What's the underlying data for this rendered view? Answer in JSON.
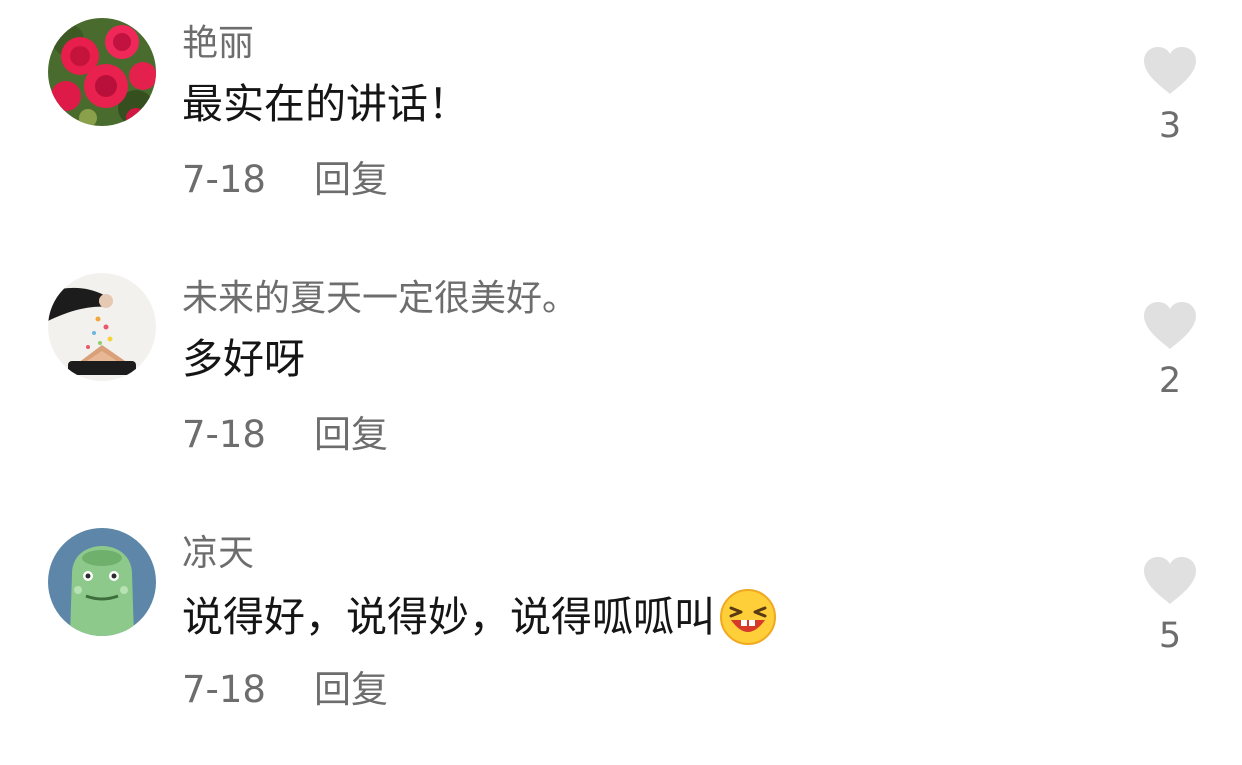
{
  "comments": [
    {
      "username": "艳丽",
      "avatar": "rose-flowers-avatar",
      "text": "最实在的讲话！",
      "date": "7-18",
      "reply_label": "回复",
      "likes": "3"
    },
    {
      "username": "未来的夏天一定很美好。",
      "avatar": "hand-sprinkling-avatar",
      "text": "多好呀",
      "date": "7-18",
      "reply_label": "回复",
      "likes": "2"
    },
    {
      "username": "凉天",
      "avatar": "green-dinosaur-avatar",
      "text": "说得好，说得妙，说得呱呱叫",
      "emoji": "laughing-face-emoji",
      "date": "7-18",
      "reply_label": "回复",
      "likes": "5"
    }
  ],
  "colors": {
    "text_primary": "#151515",
    "text_secondary": "#6d6d6d",
    "heart_gray": "#e0e0e0",
    "background": "#ffffff"
  },
  "icons": [
    "heart-icon"
  ]
}
